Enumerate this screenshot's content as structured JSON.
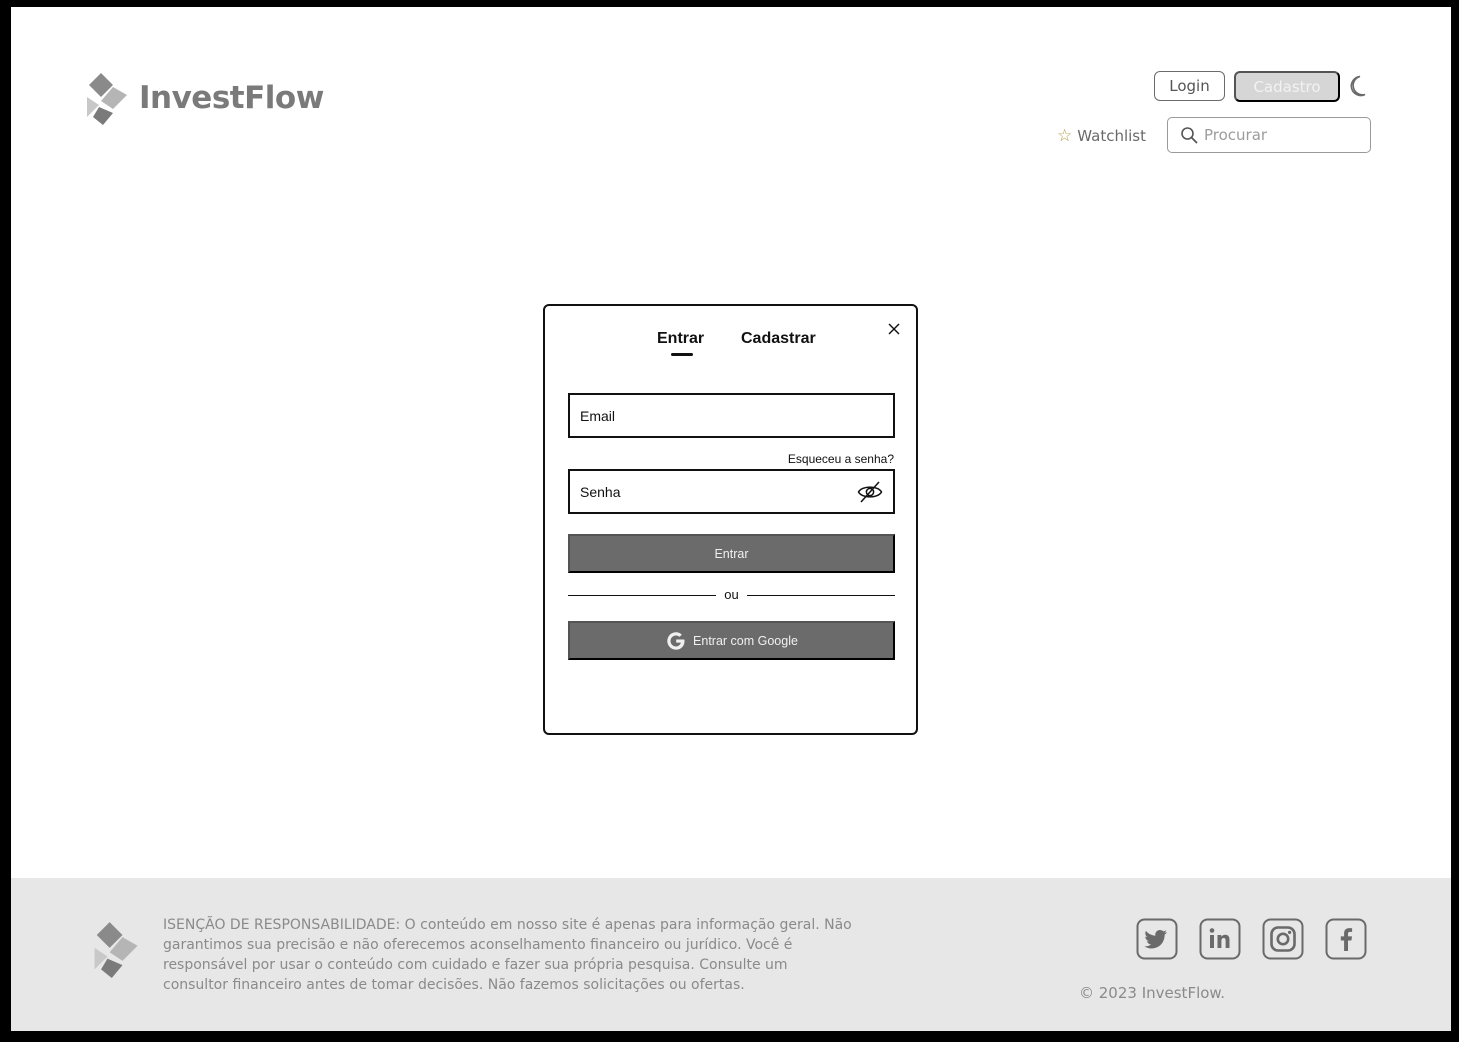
{
  "header": {
    "logo_text": "InvestFlow",
    "login_label": "Login",
    "signup_label": "Cadastro",
    "watchlist_label": "Watchlist",
    "search_placeholder": "Procurar"
  },
  "modal": {
    "tab_signin": "Entrar",
    "tab_signup": "Cadastrar",
    "email_placeholder": "Email",
    "forgot_label": "Esqueceu a senha?",
    "password_placeholder": "Senha",
    "submit_label": "Entrar",
    "divider_label": "ou",
    "google_label": "Entrar com Google"
  },
  "footer": {
    "disclaimer": "ISENÇÃO DE RESPONSABILIDADE: O conteúdo em nosso site é apenas para informação geral. Não garantimos sua precisão e não oferecemos aconselhamento financeiro ou jurídico. Você é responsável por usar o conteúdo com cuidado e fazer sua própria pesquisa. Consulte um consultor financeiro antes de tomar decisões. Não fazemos solicitações ou ofertas.",
    "copyright": "© 2023 InvestFlow.",
    "social": [
      "twitter-icon",
      "linkedin-icon",
      "instagram-icon",
      "facebook-icon"
    ]
  },
  "colors": {
    "brand_gray": "#7a7a7a",
    "button_dark": "#6b6b6b",
    "signup_disabled": "#d6d6d6",
    "star": "#b79a4a",
    "footer_bg": "#e7e7e7"
  }
}
